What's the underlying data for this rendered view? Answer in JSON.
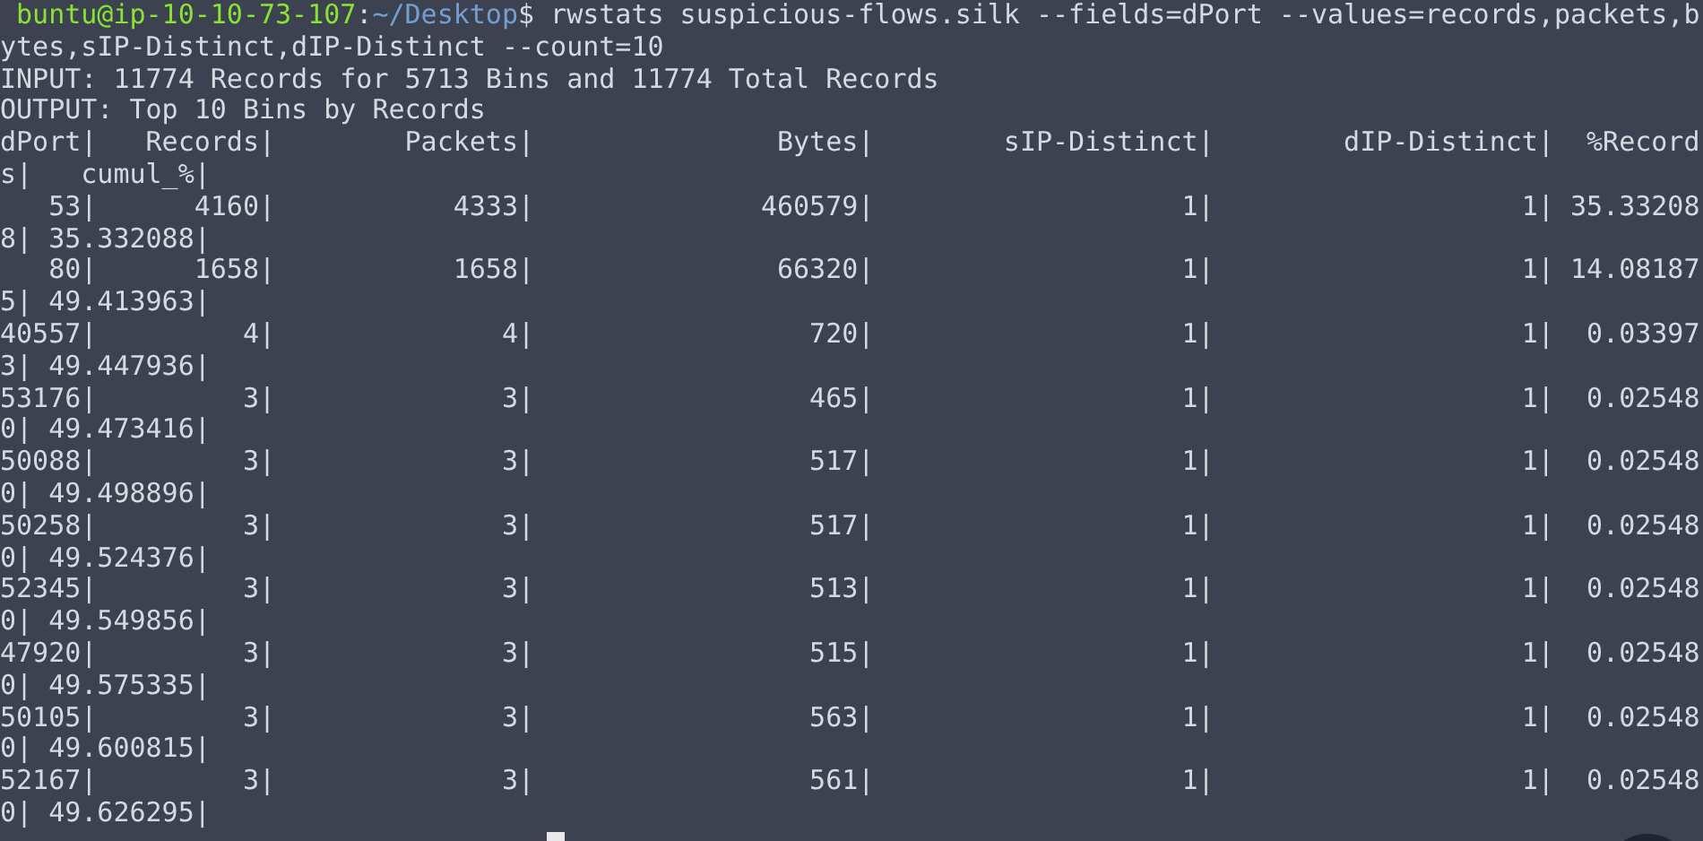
{
  "terminal": {
    "prompt": {
      "user_host": "buntu@ip-10-10-73-107",
      "separator": ":",
      "path": "~/Desktop",
      "symbol": "$",
      "command": "rwstats suspicious-flows.silk --fields=dPort --values=records,packets,bytes,sIP-Distinct,dIP-Distinct --count=10"
    },
    "info_lines": [
      "INPUT: 11774 Records for 5713 Bins and 11774 Total Records",
      "OUTPUT: Top 10 Bins by Records"
    ],
    "table": {
      "header": "dPort|   Records|        Packets|               Bytes|        sIP-Distinct|        dIP-Distinct|  %Records|   cumul_%|",
      "rows": [
        "   53|      4160|           4333|              460579|                   1|                   1| 35.332088| 35.332088|",
        "   80|      1658|           1658|               66320|                   1|                   1| 14.081875| 49.413963|",
        "40557|         4|              4|                 720|                   1|                   1|  0.033973| 49.447936|",
        "53176|         3|              3|                 465|                   1|                   1|  0.025480| 49.473416|",
        "50088|         3|              3|                 517|                   1|                   1|  0.025480| 49.498896|",
        "50258|         3|              3|                 517|                   1|                   1|  0.025480| 49.524376|",
        "52345|         3|              3|                 513|                   1|                   1|  0.025480| 49.549856|",
        "47920|         3|              3|                 515|                   1|                   1|  0.025480| 49.575335|",
        "50105|         3|              3|                 563|                   1|                   1|  0.025480| 49.600815|",
        "52167|         3|              3|                 561|                   1|                   1|  0.025480| 49.626295|"
      ]
    }
  }
}
